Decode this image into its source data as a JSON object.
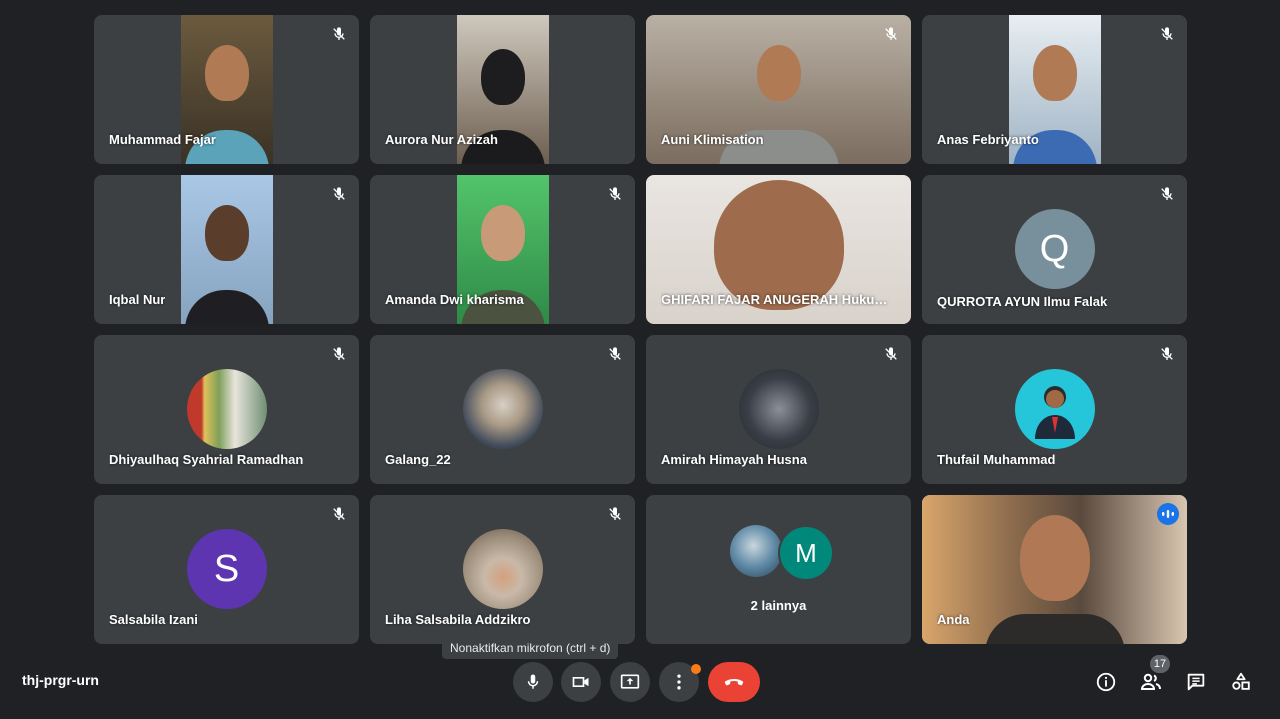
{
  "meeting_code": "thj-prgr-urn",
  "tooltip": "Nonaktifkan mikrofon (ctrl + d)",
  "participant_count": "17",
  "more": {
    "label": "2 lainnya",
    "initial": "M"
  },
  "colors": {
    "background": "#202124",
    "tile": "#3c4043",
    "end_call": "#ea4335",
    "active_outline": "#8ab4f8",
    "avatar_q": "#78909c",
    "avatar_s": "#5e35b1",
    "avatar_m": "#00897b",
    "avatar_teal": "#26c6da"
  },
  "tiles": [
    {
      "name": "Muhammad Fajar",
      "type": "video",
      "muted": true
    },
    {
      "name": "Aurora Nur Azizah",
      "type": "video",
      "muted": false
    },
    {
      "name": "Auni Klimisation",
      "type": "video-wide",
      "muted": true
    },
    {
      "name": "Anas Febriyanto",
      "type": "video",
      "muted": true
    },
    {
      "name": "Iqbal Nur",
      "type": "video",
      "muted": true
    },
    {
      "name": "Amanda Dwi kharisma",
      "type": "video",
      "muted": true
    },
    {
      "name": "GHIFARI FAJAR ANUGERAH Hukum Keluarga",
      "type": "video-wide",
      "muted": false
    },
    {
      "name": "QURROTA AYUN Ilmu Falak",
      "type": "avatar",
      "initial": "Q",
      "muted": true
    },
    {
      "name": "Dhiyaulhaq Syahrial Ramadhan",
      "type": "avatar-photo",
      "muted": true
    },
    {
      "name": "Galang_22",
      "type": "avatar-photo",
      "muted": true
    },
    {
      "name": "Amirah Himayah Husna",
      "type": "avatar-photo",
      "muted": true
    },
    {
      "name": "Thufail Muhammad",
      "type": "avatar-photo",
      "muted": true
    },
    {
      "name": "Salsabila Izani",
      "type": "avatar",
      "initial": "S",
      "muted": true
    },
    {
      "name": "Liha Salsabila Addzikro",
      "type": "avatar-photo",
      "muted": true
    },
    {
      "name": "Anda",
      "type": "self",
      "muted": false
    }
  ],
  "controls": {
    "mic": "microphone-icon",
    "camera": "camera-icon",
    "present": "present-screen-icon",
    "more": "more-vert-icon",
    "end": "end-call-icon"
  },
  "right_icons": [
    "info-icon",
    "people-icon",
    "chat-icon",
    "activities-icon"
  ]
}
